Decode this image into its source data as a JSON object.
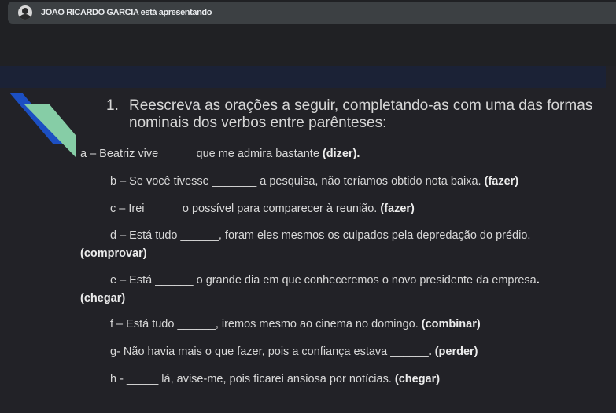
{
  "topbar": {
    "presenter": "JOAO RICARDO GARCIA está apresentando",
    "avatar_icon": "user-avatar"
  },
  "slide": {
    "colors": {
      "background": "#222227",
      "band": "#1b2236",
      "deco_blue": "#1c4fc2",
      "deco_green": "#86cda6"
    },
    "title_number": "1.",
    "title_text": "Reescreva as orações a seguir, completando-as com uma das formas nominais dos verbos entre parênteses:",
    "items": [
      {
        "text": "a – Beatriz vive _____ que me admira bastante ",
        "verb": "(dizer)."
      },
      {
        "text": "b – Se você tivesse _______ a pesquisa, não teríamos obtido nota baixa. ",
        "verb": "(fazer)"
      },
      {
        "text": "c – Irei _____ o possível para comparecer à reunião. ",
        "verb": "(fazer)"
      },
      {
        "text": "d – Está tudo ______, foram eles mesmos os culpados pela depredação do prédio.",
        "verb": "(comprovar)"
      },
      {
        "text": "e – Está ______ o grande dia em que conheceremos o novo presidente da empresa",
        "verb": ".",
        "verb2": "(chegar)"
      },
      {
        "text": "f – Está tudo ______, iremos mesmo ao cinema no domingo. ",
        "verb": "(combinar)"
      },
      {
        "text": "g- Não havia mais o que fazer, pois a confiança estava ______",
        "verb": ". (perder)"
      },
      {
        "text": "h - _____ lá, avise-me, pois ficarei ansiosa por notícias. ",
        "verb": "(chegar)"
      }
    ]
  }
}
